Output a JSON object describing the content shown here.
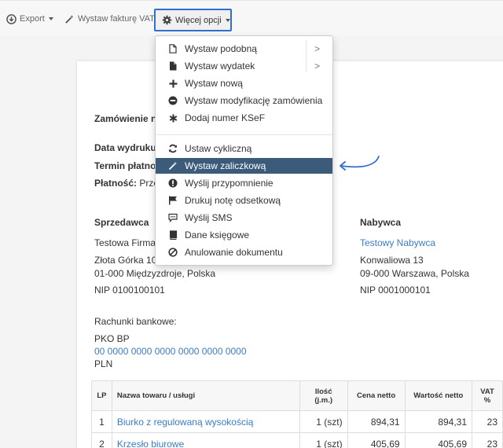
{
  "toolbar": {
    "export_label": "Export",
    "vat_label": "Wystaw fakturę VAT",
    "more_label": "Więcej opcji"
  },
  "document": {
    "order_label": "Zamówienie n",
    "print_date_label": "Data wydruku",
    "due_date_label": "Termin płatno",
    "payment_label": "Płatność:",
    "payment_value": "Prze",
    "seller": {
      "heading": "Sprzedawca",
      "name": "Testowa Firma",
      "street": "Złota Górka 10",
      "city": "01-000 Międzyzdroje, Polska",
      "nip": "NIP 0100100101"
    },
    "buyer": {
      "heading": "Nabywca",
      "name": "Testowy Nabywca",
      "street": "Konwaliowa 13",
      "city": "09-000 Warszawa, Polska",
      "nip": "NIP 0001000101"
    },
    "bank": {
      "heading": "Rachunki bankowe:",
      "bank_name": "PKO BP",
      "account": "00 0000 0000 0000 0000 0000 0000",
      "currency": "PLN"
    },
    "table": {
      "headers": {
        "lp": "LP",
        "name": "Nazwa towaru / usługi",
        "qty_line1": "Ilość",
        "qty_line2": "(j.m.)",
        "price": "Cena netto",
        "value": "Wartość netto",
        "vat": "VAT %"
      },
      "rows": [
        {
          "lp": "1",
          "name": "Biurko z regulowaną wysokością",
          "qty": "1 (szt)",
          "price": "894,31",
          "value": "894,31",
          "vat": "23"
        },
        {
          "lp": "2",
          "name": "Krzesło biurowe",
          "qty": "1 (szt)",
          "price": "405,69",
          "value": "405,69",
          "vat": "23"
        }
      ]
    }
  },
  "menu": {
    "items": [
      {
        "label": "Wystaw podobną",
        "icon": "file-icon",
        "submenu": true
      },
      {
        "label": "Wystaw wydatek",
        "icon": "file-solid-icon",
        "submenu": true
      },
      {
        "label": "Wystaw nową",
        "icon": "plus-icon",
        "submenu": false
      },
      {
        "label": "Wystaw modyfikację zamówienia",
        "icon": "minus-circle-icon",
        "submenu": false
      },
      {
        "label": "Dodaj numer KSeF",
        "icon": "asterisk-icon",
        "submenu": false
      },
      {
        "label": "Ustaw cykliczną",
        "icon": "refresh-icon",
        "submenu": false
      },
      {
        "label": "Wystaw zaliczkową",
        "icon": "magic-wand-icon",
        "submenu": false,
        "active": true
      },
      {
        "label": "Wyślij przypomnienie",
        "icon": "exclamation-circle-icon",
        "submenu": false
      },
      {
        "label": "Drukuj notę odsetkową",
        "icon": "flag-icon",
        "submenu": false
      },
      {
        "label": "Wyślij SMS",
        "icon": "sms-icon",
        "submenu": false
      },
      {
        "label": "Dane księgowe",
        "icon": "book-icon",
        "submenu": false
      },
      {
        "label": "Anulowanie dokumentu",
        "icon": "ban-icon",
        "submenu": false
      }
    ],
    "submenu_arrow": ">"
  },
  "colors": {
    "accent_border": "#2f6fcf",
    "link": "#3b7cc4",
    "active_item": "#3c5a7a",
    "annotation_arrow": "#2f6fcf"
  }
}
